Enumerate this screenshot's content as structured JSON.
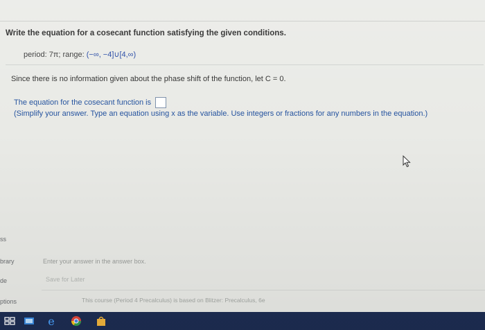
{
  "question": {
    "title": "Write the equation for a cosecant function satisfying the given conditions.",
    "period_label": "period: 7π; range:",
    "range_value": "(−∞, −4]∪[4,∞)",
    "since_text": "Since there is no information given about the phase shift of the function, let C = 0.",
    "equation_label": "The equation for the cosecant function is",
    "hint": "(Simplify your answer. Type an equation using x as the variable. Use integers or fractions for any numbers in the equation.)"
  },
  "answer_panel": {
    "enter_hint": "Enter your answer in the answer box.",
    "save_later": "Save for Later"
  },
  "footer": {
    "text": "This course (Period 4 Precalculus) is based on Blitzer: Precalculus, 6e"
  },
  "sidebar": {
    "items": [
      "ss",
      "brary",
      "de",
      "ptions"
    ]
  },
  "taskbar": {
    "icons": [
      "task-view-icon",
      "files-icon",
      "edge-icon",
      "chrome-icon",
      "store-icon"
    ]
  },
  "colors": {
    "accent_text": "#1f4e9c",
    "taskbar": "#1d2d52"
  }
}
